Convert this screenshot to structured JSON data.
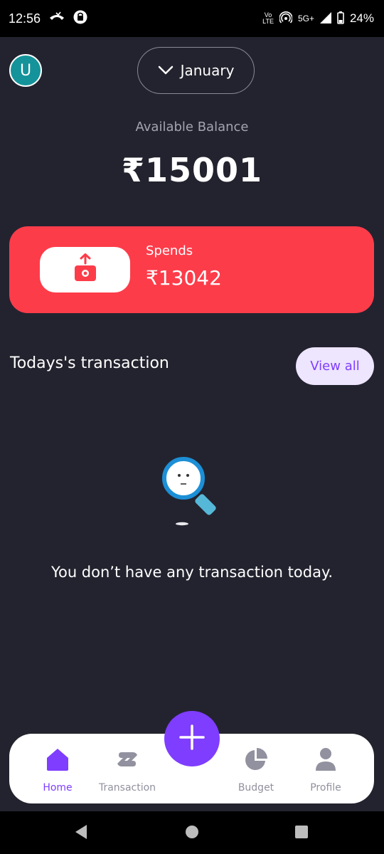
{
  "status_bar": {
    "time": "12:56",
    "volte": "Vo",
    "lte": "LTE",
    "network": "5G+",
    "battery": "24%"
  },
  "header": {
    "avatar_letter": "U",
    "month": "January"
  },
  "balance": {
    "label": "Available Balance",
    "value": "₹15001"
  },
  "spends_card": {
    "label": "Spends",
    "value": "₹13042",
    "color": "#fd3c4a"
  },
  "transactions": {
    "title": "Todays's transaction",
    "view_all": "View all",
    "empty_message": "You don’t have any transaction today."
  },
  "bottom_nav": {
    "items": [
      {
        "label": "Home",
        "icon": "home-icon",
        "active": true
      },
      {
        "label": "Transaction",
        "icon": "transfer-icon",
        "active": false
      },
      {
        "label": "Budget",
        "icon": "pie-chart-icon",
        "active": false
      },
      {
        "label": "Profile",
        "icon": "user-icon",
        "active": false
      }
    ],
    "fab_icon": "plus-icon"
  },
  "colors": {
    "accent": "#7f3dff",
    "background": "#23232f",
    "inactive": "#91919f"
  }
}
